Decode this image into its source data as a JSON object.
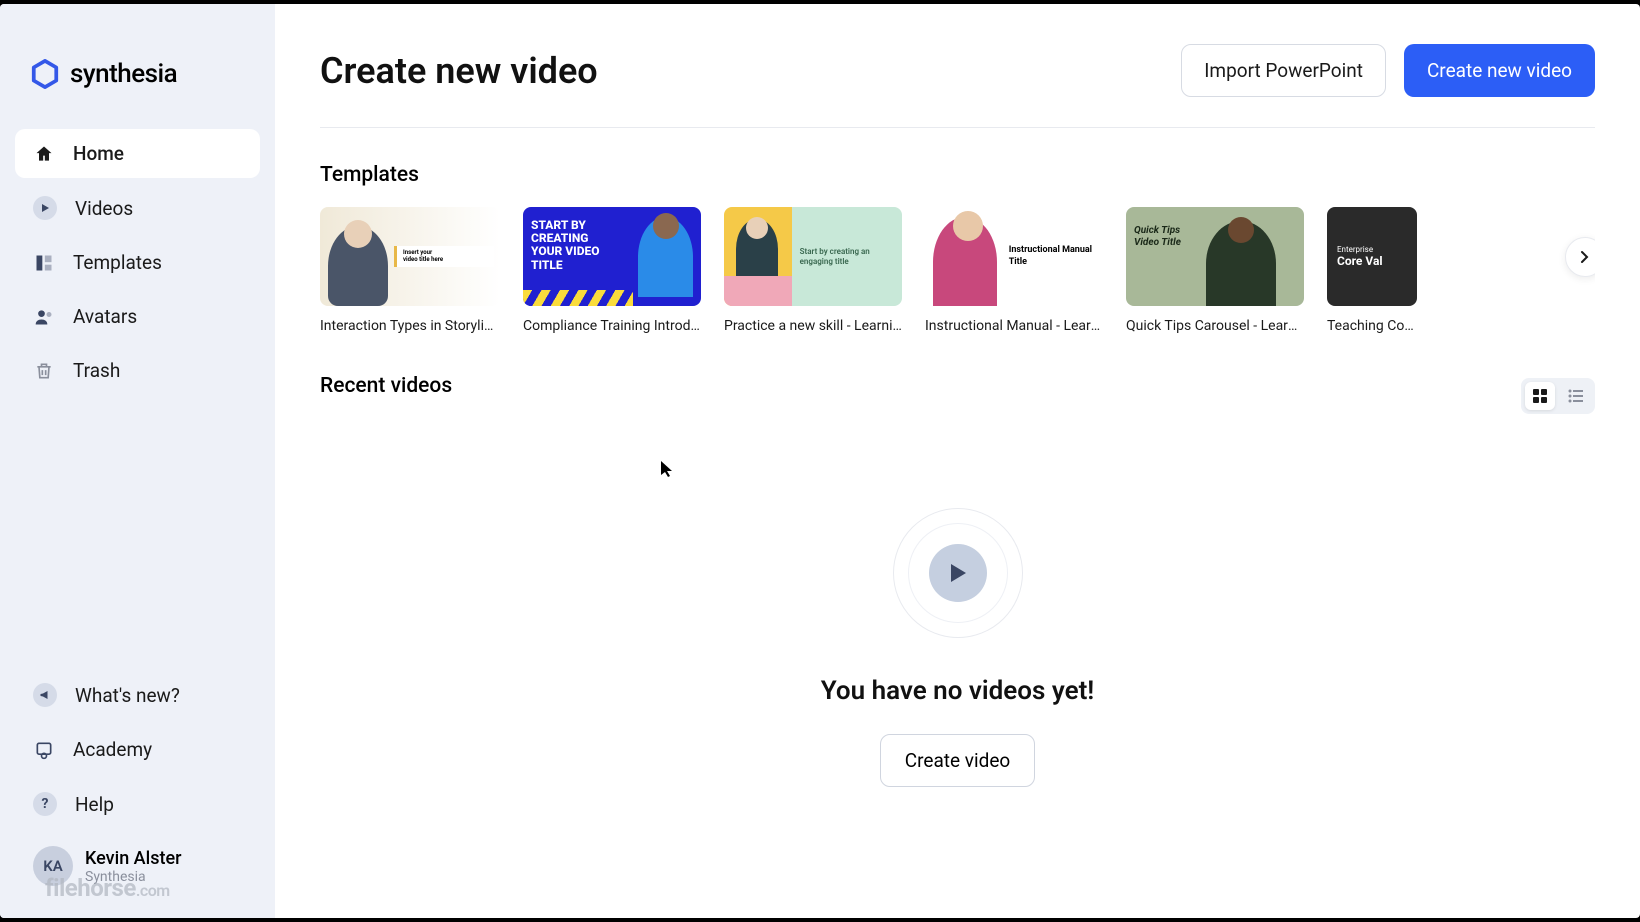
{
  "brand": "synthesia",
  "sidebar": {
    "nav": [
      {
        "label": "Home",
        "icon": "home",
        "active": true
      },
      {
        "label": "Videos",
        "icon": "play"
      },
      {
        "label": "Templates",
        "icon": "templates"
      },
      {
        "label": "Avatars",
        "icon": "avatars"
      },
      {
        "label": "Trash",
        "icon": "trash"
      }
    ],
    "bottom": [
      {
        "label": "What's new?",
        "icon": "megaphone"
      },
      {
        "label": "Academy",
        "icon": "academy"
      },
      {
        "label": "Help",
        "icon": "help"
      }
    ],
    "user": {
      "initials": "KA",
      "name": "Kevin Alster",
      "org": "Synthesia"
    },
    "watermark": "filehorse",
    "watermark_suffix": ".com"
  },
  "header": {
    "title": "Create new video",
    "actions": {
      "import": "Import PowerPoint",
      "create": "Create new video"
    }
  },
  "templates_section": {
    "title": "Templates",
    "items": [
      {
        "label": "Interaction Types in Storyline ...",
        "thumb_text_1": "Insert your",
        "thumb_text_2": "video title here"
      },
      {
        "label": "Compliance Training Introduc...",
        "thumb_text": "START BY CREATING YOUR VIDEO TITLE"
      },
      {
        "label": "Practice a new skill - Learning...",
        "thumb_text": "Start by creating an engaging title"
      },
      {
        "label": "Instructional Manual - Learni...",
        "thumb_text": "Instructional Manual Title"
      },
      {
        "label": "Quick Tips Carousel - Learnin...",
        "thumb_text": "Quick Tips Video Title"
      },
      {
        "label": "Teaching Core V...",
        "thumb_text_1": "Enterprise",
        "thumb_text_2": "Core Val"
      }
    ]
  },
  "recent_section": {
    "title": "Recent videos",
    "empty_title": "You have no videos yet!",
    "create_btn": "Create video"
  }
}
